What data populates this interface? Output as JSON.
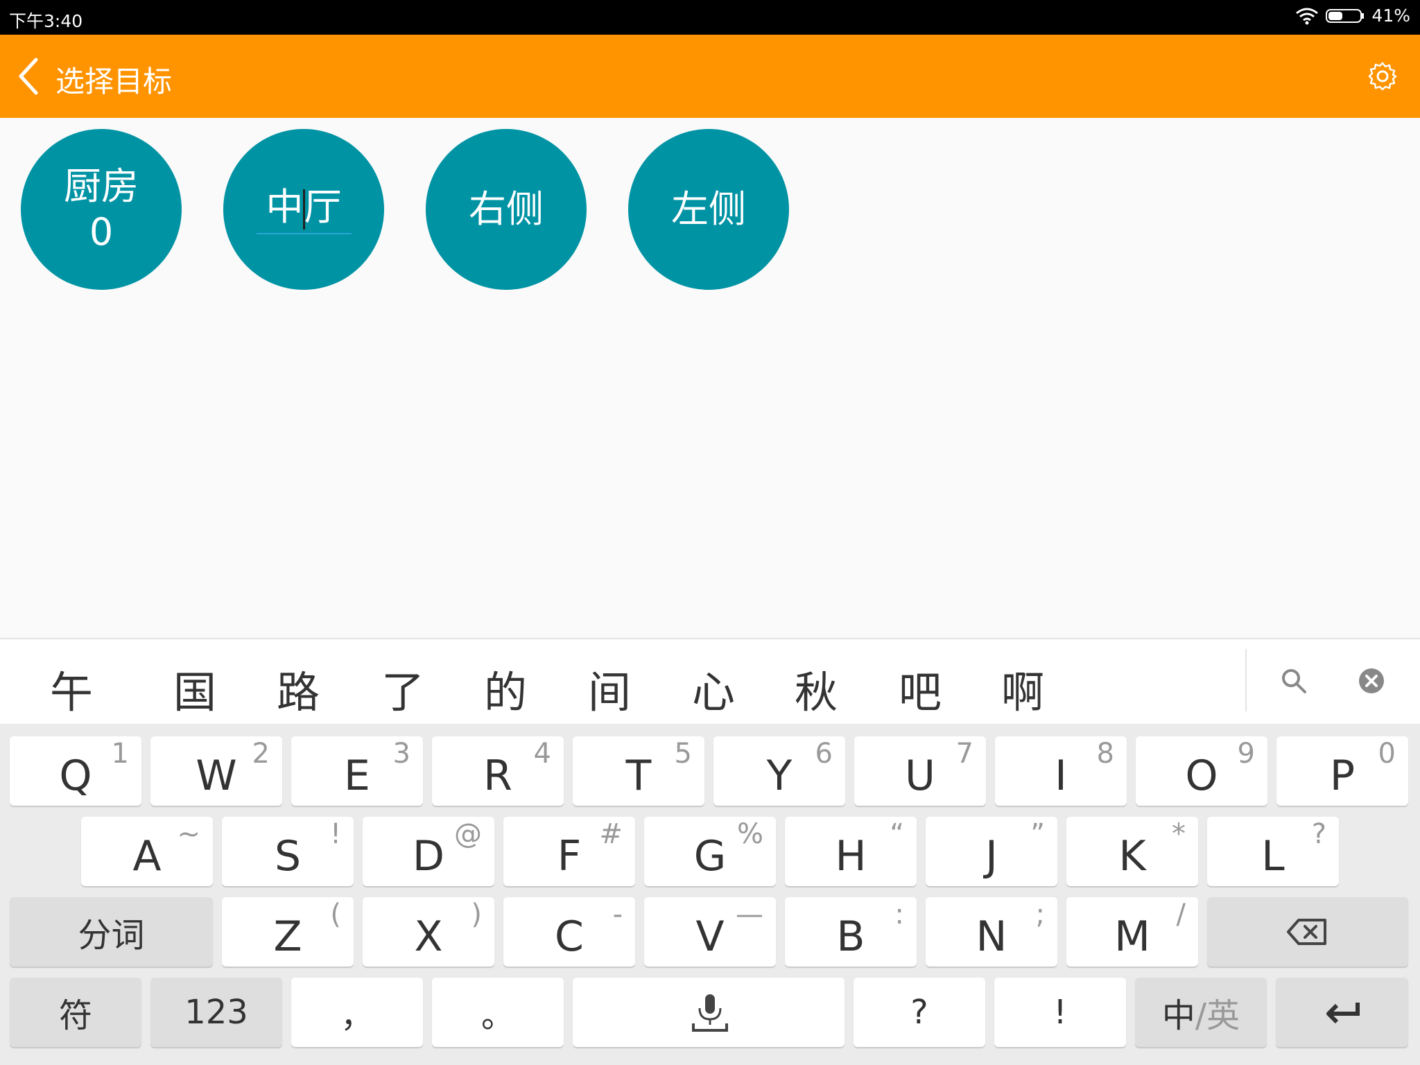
{
  "status": {
    "time": "下午3:40",
    "battery": "41%",
    "icons": [
      "wifi-icon",
      "battery-icon"
    ]
  },
  "appbar": {
    "title": "选择目标",
    "back_icon": "chevron-left-icon",
    "settings_icon": "gear-icon",
    "color": "#ff9300"
  },
  "targets": [
    {
      "line1": "厨房",
      "line2": "0"
    },
    {
      "text_a": "中",
      "text_b": "厅"
    },
    {
      "label": "右侧"
    },
    {
      "label": "左侧"
    }
  ],
  "candidates": [
    "午",
    "国",
    "路",
    "了",
    "的",
    "间",
    "心",
    "秋",
    "吧",
    "啊"
  ],
  "keyboard": {
    "row1": [
      {
        "k": "Q",
        "s": "1"
      },
      {
        "k": "W",
        "s": "2"
      },
      {
        "k": "E",
        "s": "3"
      },
      {
        "k": "R",
        "s": "4"
      },
      {
        "k": "T",
        "s": "5"
      },
      {
        "k": "Y",
        "s": "6"
      },
      {
        "k": "U",
        "s": "7"
      },
      {
        "k": "I",
        "s": "8"
      },
      {
        "k": "O",
        "s": "9"
      },
      {
        "k": "P",
        "s": "0"
      }
    ],
    "row2": [
      {
        "k": "A",
        "s": "~"
      },
      {
        "k": "S",
        "s": "!"
      },
      {
        "k": "D",
        "s": "@"
      },
      {
        "k": "F",
        "s": "#"
      },
      {
        "k": "G",
        "s": "%"
      },
      {
        "k": "H",
        "s": "“"
      },
      {
        "k": "J",
        "s": "”"
      },
      {
        "k": "K",
        "s": "*"
      },
      {
        "k": "L",
        "s": "?"
      }
    ],
    "row3_left": "分词",
    "row3": [
      {
        "k": "Z",
        "s": "("
      },
      {
        "k": "X",
        "s": ")"
      },
      {
        "k": "C",
        "s": "-"
      },
      {
        "k": "V",
        "s": "—"
      },
      {
        "k": "B",
        "s": ":"
      },
      {
        "k": "N",
        "s": ";"
      },
      {
        "k": "M",
        "s": "/"
      }
    ],
    "row4": {
      "symbols": "符",
      "numbers": "123",
      "comma": "，",
      "period": "。",
      "question": "?",
      "exclaim": "!",
      "lang_a": "中",
      "lang_b": "/英"
    }
  }
}
